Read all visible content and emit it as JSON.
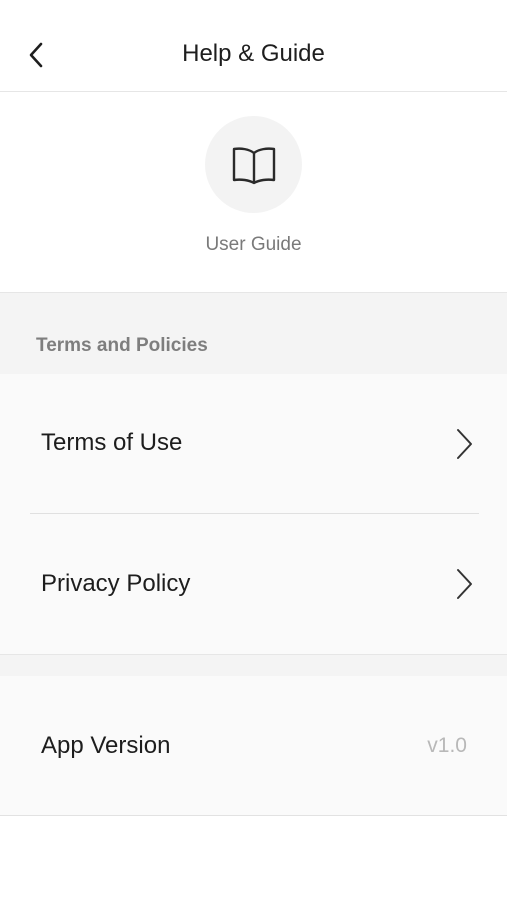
{
  "header": {
    "title": "Help & Guide",
    "back_icon": "chevron-left-icon"
  },
  "guide": {
    "label": "User Guide",
    "icon": "book-icon"
  },
  "terms_section": {
    "title": "Terms and Policies",
    "items": [
      {
        "label": "Terms of Use",
        "icon": "chevron-right-icon"
      },
      {
        "label": "Privacy Policy",
        "icon": "chevron-right-icon"
      }
    ]
  },
  "version": {
    "label": "App Version",
    "value": "v1.0"
  },
  "colors": {
    "background": "#ffffff",
    "section_background": "#f4f4f4",
    "text_primary": "#1d1d1d",
    "text_secondary": "#7a7a7a",
    "text_muted": "#b8b8b8"
  }
}
